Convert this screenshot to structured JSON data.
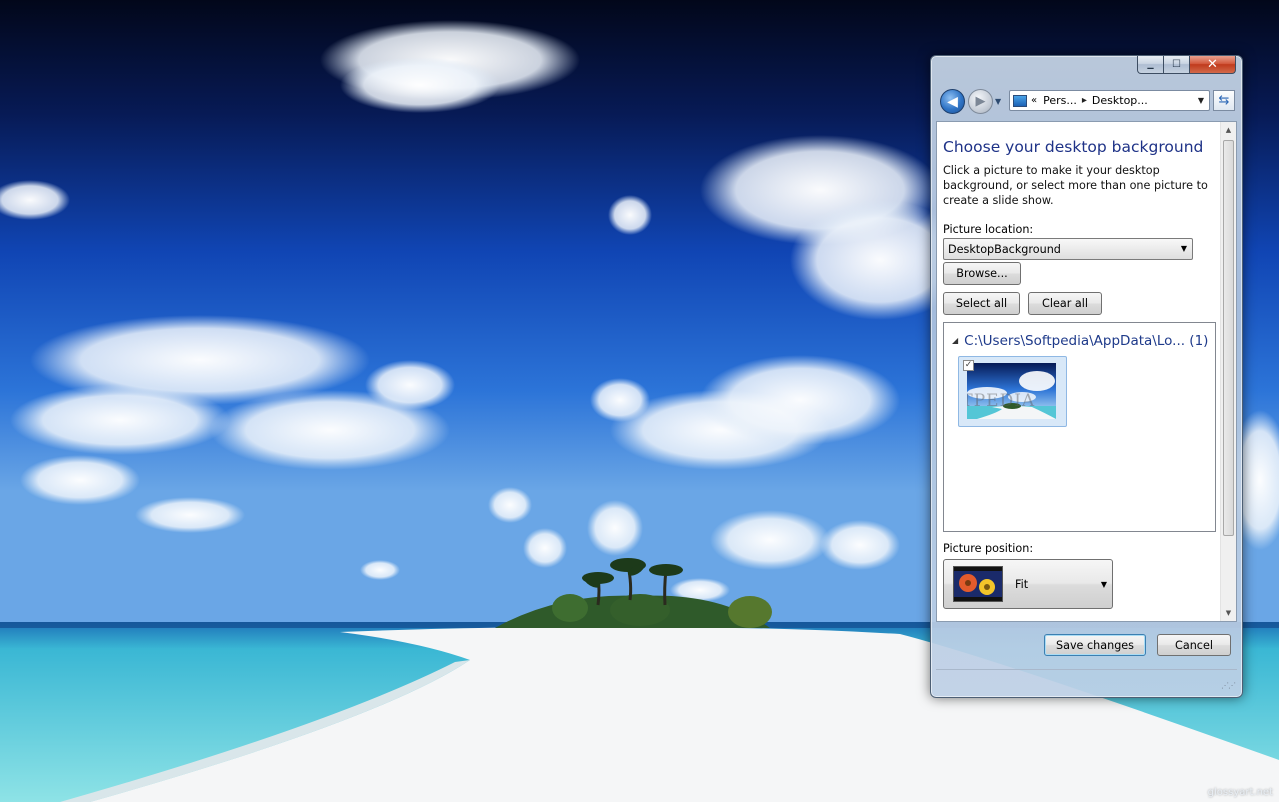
{
  "wallpaper": {
    "credit": "glossyart.net"
  },
  "window": {
    "caption_buttons": {
      "minimize": "▁",
      "maximize": "☐",
      "close": "✕"
    },
    "address_bar": {
      "crumb_prefix": "«",
      "crumbs": [
        "Pers...",
        "Desktop..."
      ],
      "separator": "▸"
    },
    "page_title": "Choose your desktop background",
    "description": "Click a picture to make it your desktop background, or select more than one picture to create a slide show.",
    "picture_location": {
      "label": "Picture location:",
      "value": "DesktopBackground"
    },
    "buttons": {
      "browse": "Browse...",
      "select_all": "Select all",
      "clear_all": "Clear all",
      "save": "Save changes",
      "cancel": "Cancel"
    },
    "gallery": {
      "group_header": "C:\\Users\\Softpedia\\AppData\\Lo... (1)",
      "thumbnail": {
        "checked": true,
        "watermark": "SOFTPEDIA"
      }
    },
    "picture_position": {
      "label": "Picture position:",
      "value": "Fit"
    }
  },
  "colors": {
    "title_blue": "#1e3287",
    "link_blue": "#1e3a8a",
    "sky_top": "#04102e",
    "sky_mid": "#1454c8",
    "sea": "#5fd0da",
    "sand": "#f7f8f9"
  }
}
